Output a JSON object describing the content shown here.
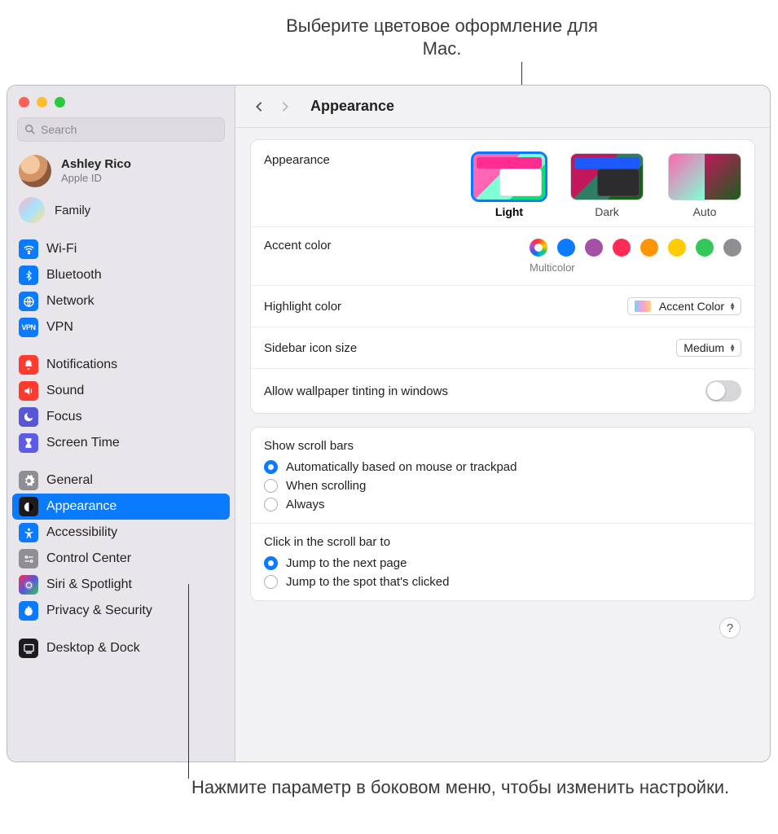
{
  "callouts": {
    "top": "Выберите цветовое оформление для Mac.",
    "bottom": "Нажмите параметр в боковом меню, чтобы изменить настройки."
  },
  "search": {
    "placeholder": "Search"
  },
  "user": {
    "name": "Ashley Rico",
    "sub": "Apple ID"
  },
  "family": {
    "label": "Family"
  },
  "sidebar": {
    "group1": [
      {
        "label": "Wi-Fi",
        "color": "ic-blue",
        "glyph": "wifi"
      },
      {
        "label": "Bluetooth",
        "color": "ic-blue",
        "glyph": "bt"
      },
      {
        "label": "Network",
        "color": "ic-blue",
        "glyph": "net"
      },
      {
        "label": "VPN",
        "color": "ic-blue",
        "glyph": "vpn"
      }
    ],
    "group2": [
      {
        "label": "Notifications",
        "color": "ic-red",
        "glyph": "bell"
      },
      {
        "label": "Sound",
        "color": "ic-red",
        "glyph": "sound"
      },
      {
        "label": "Focus",
        "color": "ic-purple",
        "glyph": "moon"
      },
      {
        "label": "Screen Time",
        "color": "ic-indigo",
        "glyph": "hour"
      }
    ],
    "group3": [
      {
        "label": "General",
        "color": "ic-gray",
        "glyph": "gear"
      },
      {
        "label": "Appearance",
        "color": "ic-black",
        "glyph": "appear",
        "selected": true
      },
      {
        "label": "Accessibility",
        "color": "ic-blue",
        "glyph": "acc"
      },
      {
        "label": "Control Center",
        "color": "ic-gray",
        "glyph": "cc"
      },
      {
        "label": "Siri & Spotlight",
        "color": "ic-siri",
        "glyph": "siri"
      },
      {
        "label": "Privacy & Security",
        "color": "ic-hand",
        "glyph": "hand"
      }
    ],
    "group4": [
      {
        "label": "Desktop & Dock",
        "color": "ic-black",
        "glyph": "dock"
      }
    ]
  },
  "header": {
    "title": "Appearance"
  },
  "appearance": {
    "label": "Appearance",
    "options": {
      "light": "Light",
      "dark": "Dark",
      "auto": "Auto"
    },
    "selected": "light"
  },
  "accent": {
    "label": "Accent color",
    "selected_name": "Multicolor",
    "colors": [
      "#0a7aff",
      "#a550a7",
      "#ff2d55",
      "#ff9500",
      "#ffcc00",
      "#34c759",
      "#8e8e93"
    ]
  },
  "highlight": {
    "label": "Highlight color",
    "value": "Accent Color"
  },
  "sidebar_size": {
    "label": "Sidebar icon size",
    "value": "Medium"
  },
  "tinting": {
    "label": "Allow wallpaper tinting in windows",
    "on": false
  },
  "scrollbars": {
    "title": "Show scroll bars",
    "options": [
      "Automatically based on mouse or trackpad",
      "When scrolling",
      "Always"
    ],
    "selected": 0
  },
  "scrollclick": {
    "title": "Click in the scroll bar to",
    "options": [
      "Jump to the next page",
      "Jump to the spot that's clicked"
    ],
    "selected": 0
  },
  "help": "?"
}
